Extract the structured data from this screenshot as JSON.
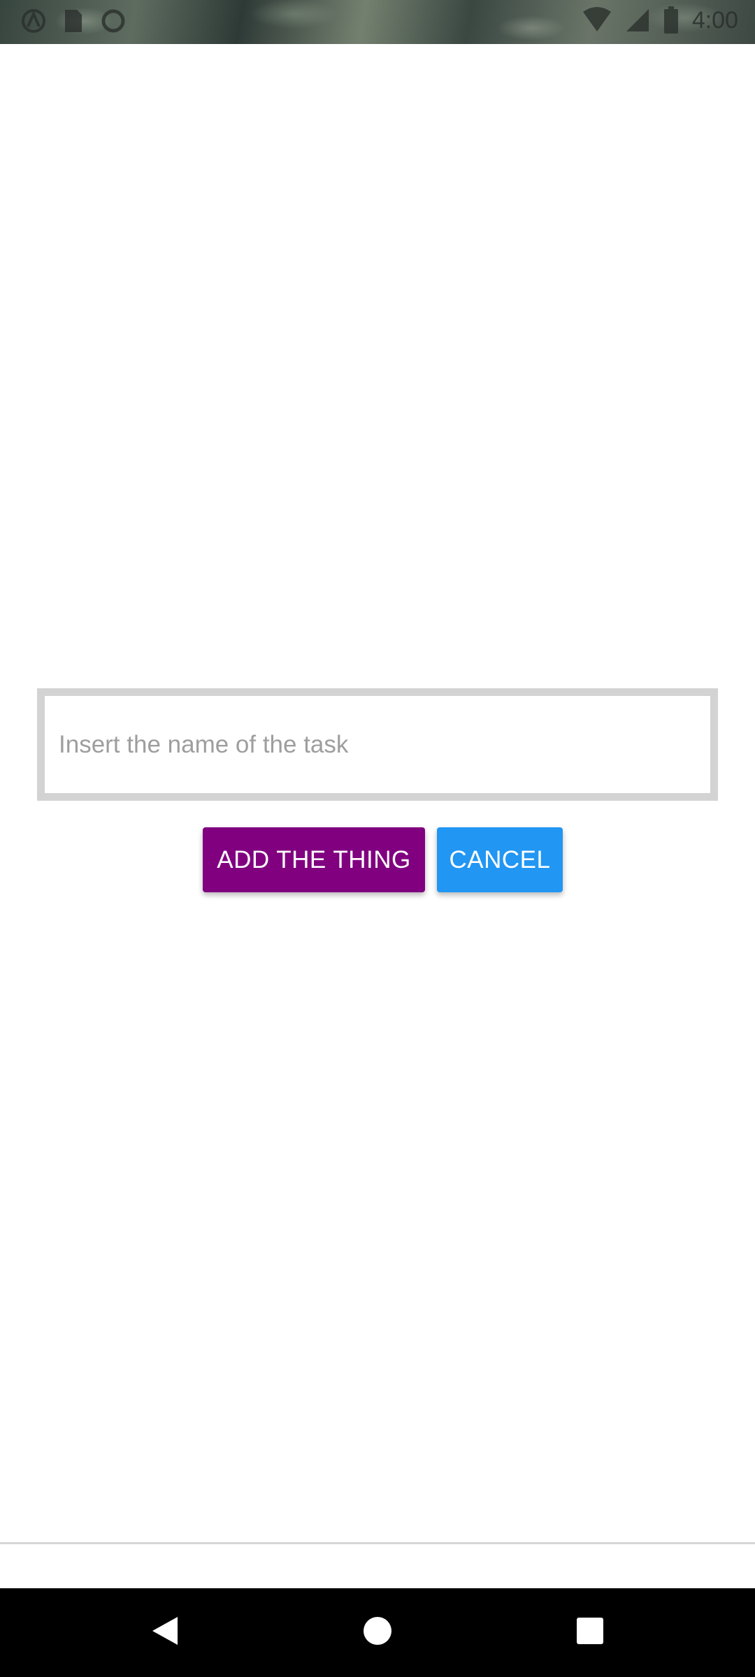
{
  "status_bar": {
    "time": "4:00",
    "left_icons": [
      "alert-icon",
      "sim-card-icon",
      "sync-circle-icon"
    ],
    "right_icons": [
      "wifi-icon",
      "signal-icon",
      "battery-icon"
    ]
  },
  "task_form": {
    "input_value": "",
    "input_placeholder": "Insert the name of the task",
    "add_button_label": "ADD THE THING",
    "cancel_button_label": "CANCEL"
  },
  "colors": {
    "add_button": "#800080",
    "cancel_button": "#2196f3",
    "input_border": "#d3d3d3"
  },
  "nav_bar": {
    "buttons": [
      "back-icon",
      "home-icon",
      "recents-icon"
    ]
  }
}
